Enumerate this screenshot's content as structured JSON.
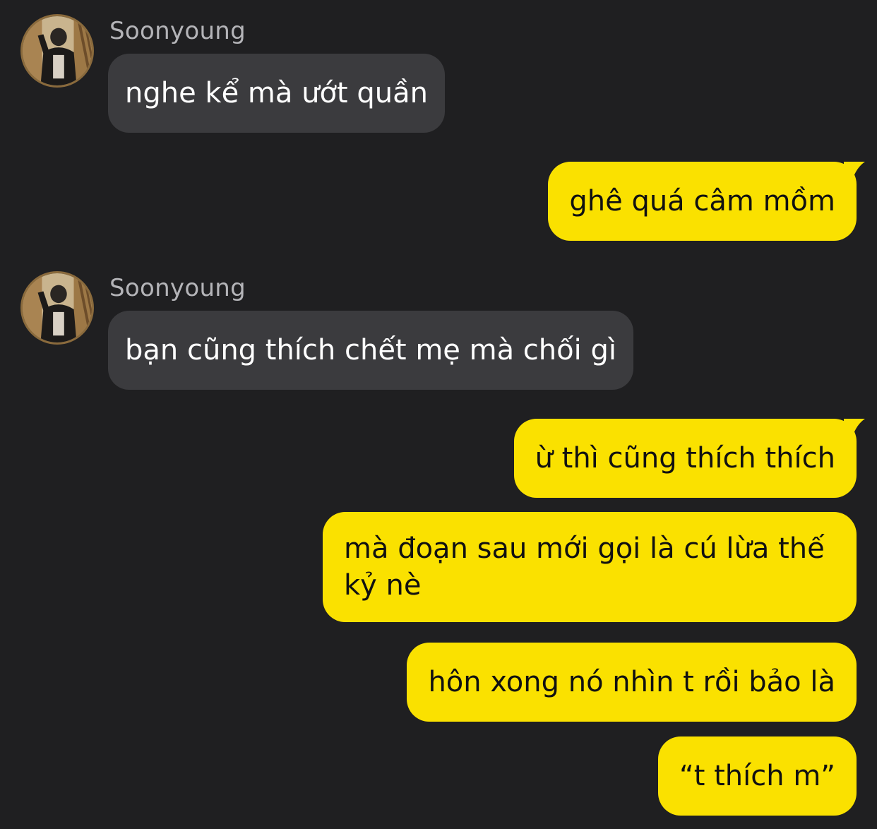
{
  "conversation": {
    "messages": [
      {
        "type": "incoming",
        "sender": "Soonyoung",
        "text": "nghe kể mà ướt quần"
      },
      {
        "type": "outgoing",
        "text": "ghê quá câm mồm"
      },
      {
        "type": "incoming",
        "sender": "Soonyoung",
        "text": "bạn cũng thích chết mẹ mà chối gì"
      },
      {
        "type": "outgoing",
        "text": "ừ thì cũng thích thích"
      },
      {
        "type": "outgoing",
        "text": "mà đoạn sau mới gọi là cú lừa thế kỷ nè"
      },
      {
        "type": "outgoing",
        "text": "hôn xong nó nhìn t rồi bảo là"
      },
      {
        "type": "outgoing",
        "text": "“t thích m”"
      }
    ]
  },
  "colors": {
    "background": "#1f1f21",
    "incoming_bubble": "#3b3b3e",
    "outgoing_bubble": "#fae100",
    "sender_name": "#b4b4b8"
  },
  "icons": {
    "avatar": "profile-photo-person-in-black-jacket"
  }
}
